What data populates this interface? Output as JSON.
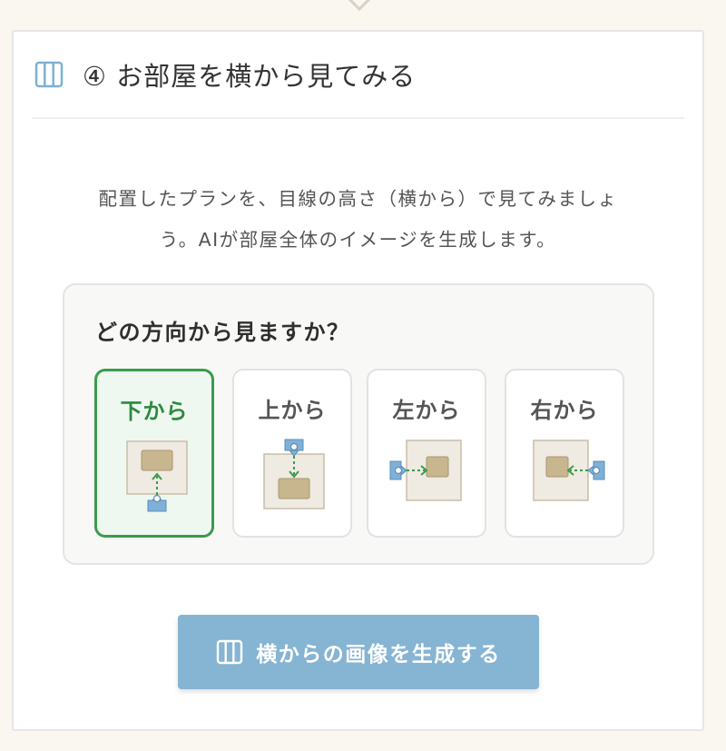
{
  "section": {
    "title": "④ お部屋を横から見てみる",
    "description_line1": "配置したプランを、目線の高さ（横から）で見てみましょ",
    "description_line2": "う。AIが部屋全体のイメージを生成します。"
  },
  "direction_panel": {
    "question": "どの方向から見ますか？",
    "options": [
      {
        "label": "下から",
        "selected": true,
        "icon": "view-from-bottom-icon"
      },
      {
        "label": "上から",
        "selected": false,
        "icon": "view-from-top-icon"
      },
      {
        "label": "左から",
        "selected": false,
        "icon": "view-from-left-icon"
      },
      {
        "label": "右から",
        "selected": false,
        "icon": "view-from-right-icon"
      }
    ]
  },
  "generate_button": {
    "label": "横からの画像を生成する",
    "icon": "columns-icon"
  },
  "colors": {
    "accent_blue": "#86b4d3",
    "selected_green": "#3a9b4c",
    "selected_bg": "#eef8f0",
    "room_fill": "#efeae2",
    "furniture_fill": "#c8b78e",
    "camera_blue": "#7fb0d8",
    "arrow_green": "#3a9b4c"
  }
}
